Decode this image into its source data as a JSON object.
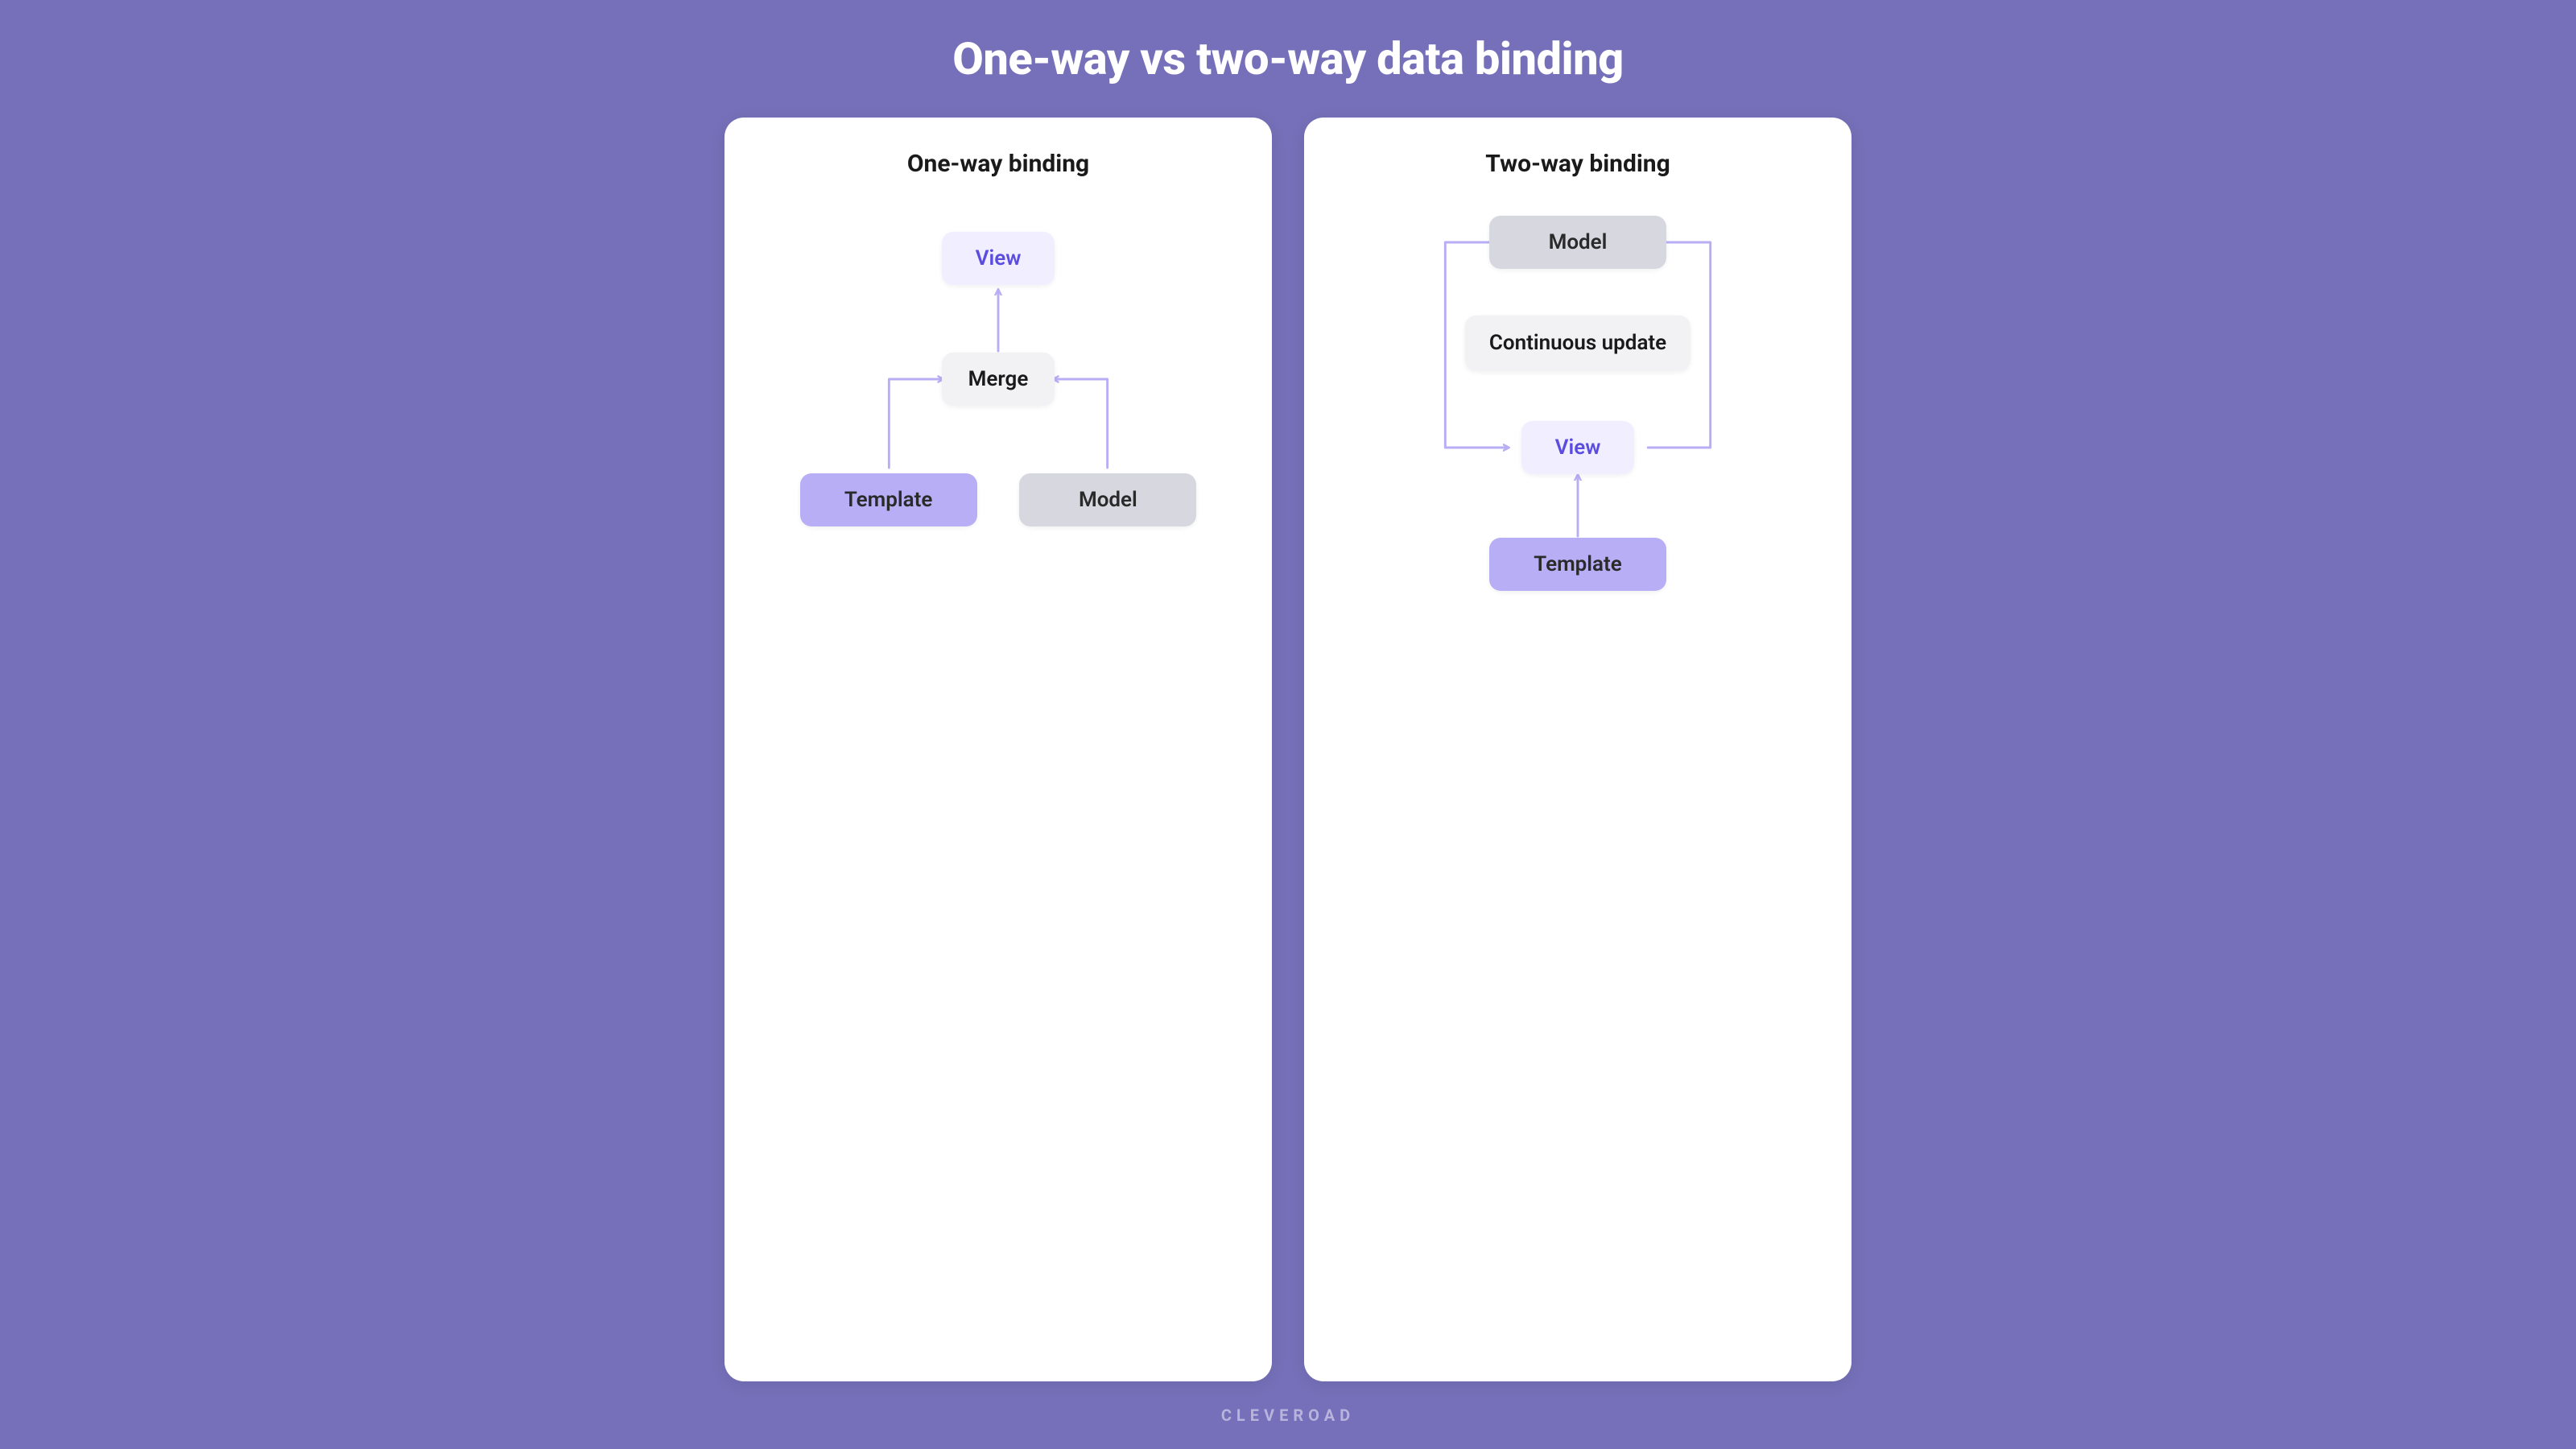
{
  "title": "One-way vs two-way data binding",
  "brand": "CLEVEROAD",
  "colors": {
    "background": "#7570b9",
    "panel": "#ffffff",
    "arrow": "#b8aef5",
    "view_bg": "#f1efff",
    "view_fg": "#5a4de0",
    "merge_bg": "#f2f2f5",
    "template_bg": "#b8aef5",
    "model_bg": "#d7d7e0"
  },
  "panels": {
    "one_way": {
      "title": "One-way binding",
      "nodes": {
        "view": "View",
        "merge": "Merge",
        "template": "Template",
        "model": "Model"
      },
      "flow": [
        {
          "from": "template",
          "to": "merge"
        },
        {
          "from": "model",
          "to": "merge"
        },
        {
          "from": "merge",
          "to": "view"
        }
      ]
    },
    "two_way": {
      "title": "Two-way binding",
      "nodes": {
        "model": "Model",
        "update": "Continuous update",
        "view": "View",
        "template": "Template"
      },
      "flow": [
        {
          "from": "template",
          "to": "view"
        },
        {
          "from": "view",
          "to": "model",
          "side": "right"
        },
        {
          "from": "model",
          "to": "view",
          "side": "left"
        }
      ]
    }
  }
}
